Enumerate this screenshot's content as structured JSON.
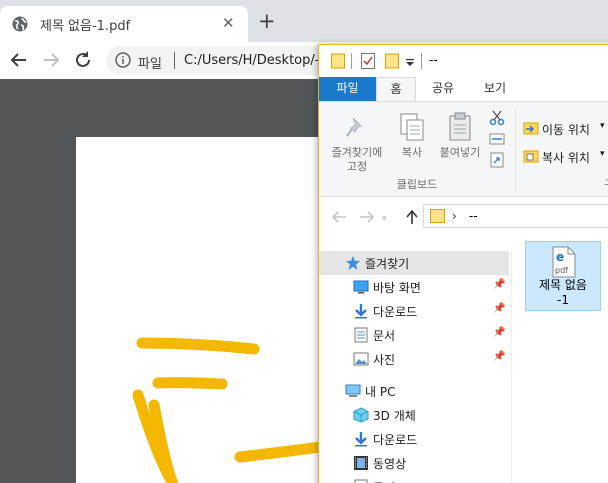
{
  "browser": {
    "tab_title": "제목 없음-1.pdf",
    "tab_close": "✕",
    "new_tab": "+",
    "omnibox_label": "파일",
    "url": "C:/Users/H/Desktop/--"
  },
  "explorer": {
    "title": "--",
    "ribbon_tabs": [
      "파일",
      "홈",
      "공유",
      "보기"
    ],
    "ribbon": {
      "pin_label_line1": "즐겨찾기에",
      "pin_label_line2": "고정",
      "copy_label": "복사",
      "paste_label": "붙여넣기",
      "group_label": "클립보드",
      "move_to": "이동 위치",
      "copy_to": "복사 위치",
      "dropdown_glyph": "▾",
      "next_group_cut": "구"
    },
    "address": {
      "path": "--",
      "chevron": "›"
    },
    "nav": {
      "favorites": "즐겨찾기",
      "quick_access": [
        {
          "label": "바탕 화면",
          "icon": "desktop-icon"
        },
        {
          "label": "다운로드",
          "icon": "download-icon"
        },
        {
          "label": "문서",
          "icon": "document-icon"
        },
        {
          "label": "사진",
          "icon": "pictures-icon"
        }
      ],
      "this_pc": "내 PC",
      "pc_items": [
        {
          "label": "3D 개체",
          "icon": "3d-objects-icon"
        },
        {
          "label": "다운로드",
          "icon": "download-icon"
        },
        {
          "label": "동영상",
          "icon": "video-icon"
        },
        {
          "label": "문서",
          "icon": "document-icon"
        }
      ],
      "pin_glyph": "📌"
    },
    "files": [
      {
        "name_line1": "제목 없음",
        "name_line2": "-1",
        "icon": "pdf-file-icon",
        "icon_text": "pdf"
      }
    ]
  },
  "colors": {
    "chrome_tabstrip": "#dee1e6",
    "pdf_background": "#525659",
    "explorer_accent": "#1979ca",
    "selection": "#cce8ff",
    "stroke": "#f5b800"
  }
}
